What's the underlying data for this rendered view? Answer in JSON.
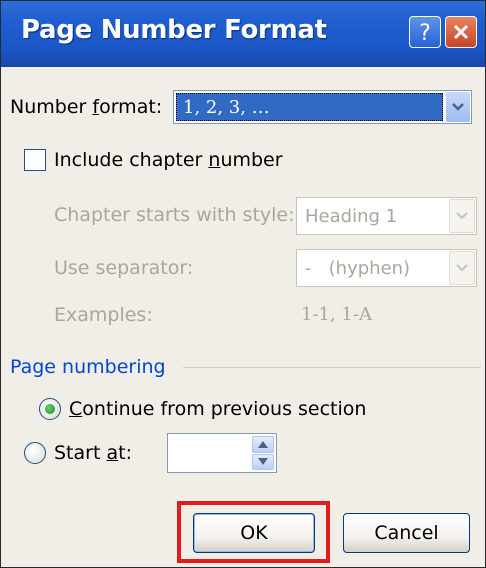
{
  "dialog": {
    "title": "Page Number Format",
    "number_format": {
      "label_prefix": "Number ",
      "label_key": "f",
      "label_suffix": "ormat:",
      "value": "1, 2, 3, …"
    },
    "include_chapter": {
      "label_prefix": "Include chapter ",
      "label_key": "n",
      "label_suffix": "umber",
      "checked": false
    },
    "chapter_style": {
      "label": "Chapter starts with style:",
      "value": "Heading 1"
    },
    "separator": {
      "label": "Use separator:",
      "value": "-   (hyphen)"
    },
    "examples": {
      "label": "Examples:",
      "value": "1-1, 1-A"
    },
    "page_numbering": {
      "group_label": "Page numbering",
      "continue": {
        "label_key": "C",
        "label_rest": "ontinue from previous section",
        "selected": true
      },
      "start_at": {
        "label_prefix": "Start ",
        "label_key": "a",
        "label_suffix": "t:",
        "selected": false,
        "value": ""
      }
    },
    "buttons": {
      "ok": "OK",
      "cancel": "Cancel"
    },
    "colors": {
      "title_bar": "#1f5fd0",
      "highlight": "#e31b1b",
      "dialog_bg": "#f0eee6",
      "selection": "#316ac5"
    },
    "icons": [
      "help-icon",
      "close-icon",
      "chevron-down-icon",
      "spin-up-icon",
      "spin-down-icon"
    ]
  }
}
